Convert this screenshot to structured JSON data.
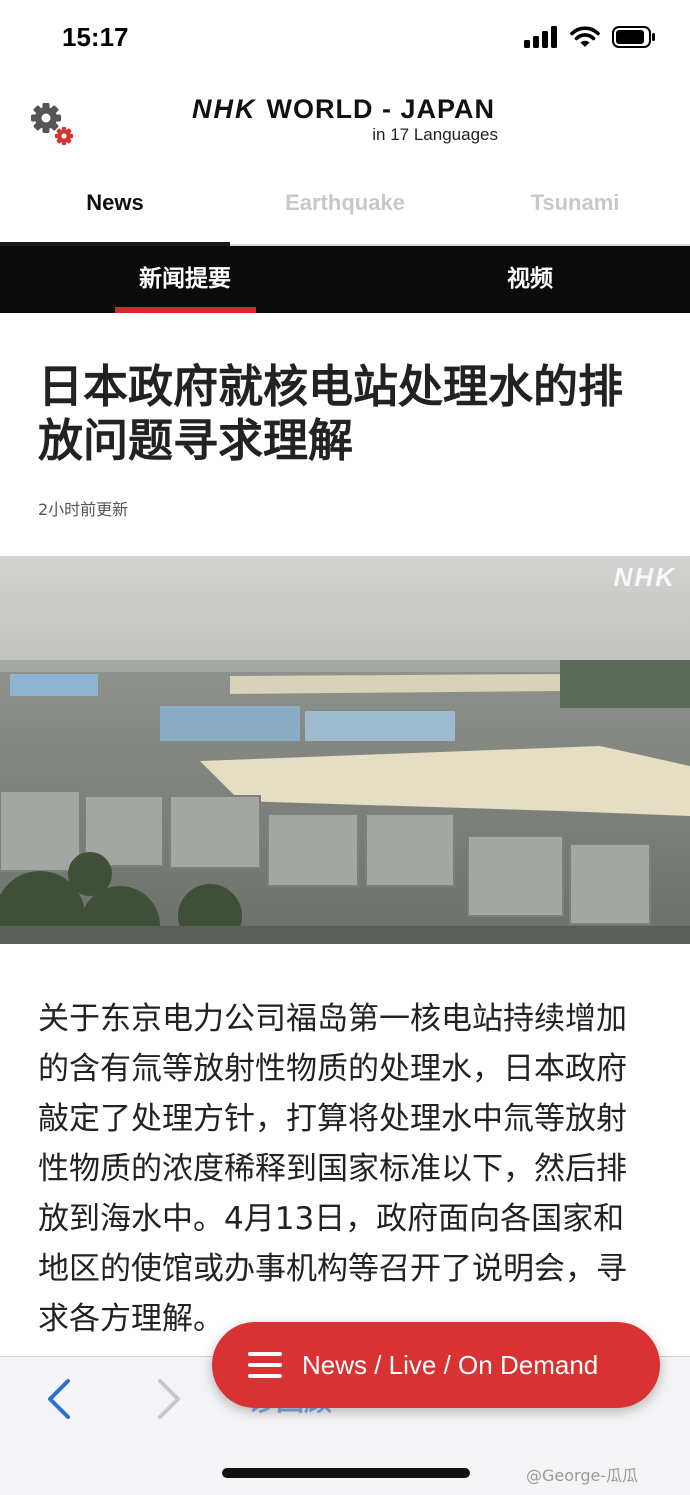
{
  "status_bar": {
    "time": "15:17",
    "icons": [
      "signal-icon",
      "wifi-icon",
      "battery-icon"
    ]
  },
  "header": {
    "logo_nhk": "NHK",
    "logo_rest": "WORLD - JAPAN",
    "subtitle": "in 17 Languages",
    "settings_icon": "gear-icon"
  },
  "tabs": [
    {
      "label": "News",
      "active": true
    },
    {
      "label": "Earthquake",
      "active": false
    },
    {
      "label": "Tsunami",
      "active": false
    }
  ],
  "subnav": [
    {
      "label": "新闻提要",
      "active": true
    },
    {
      "label": "视频",
      "active": false
    }
  ],
  "article": {
    "headline": "日本政府就核电站处理水的排放问题寻求理解",
    "updated": "2小时前更新",
    "photo_watermark": "NHK",
    "body": "关于东京电力公司福岛第一核电站持续增加的含有氚等放射性物质的处理水，日本政府敲定了处理方针，打算将处理水中氚等放射性物质的浓度稀释到国家标准以下，然后排放到海水中。4月13日，政府面向各国家和地区的使馆或办事机构等召开了说明会，寻求各方理解。"
  },
  "fab": {
    "label": "News / Live / On Demand",
    "icon": "menu-icon"
  },
  "browser_bar": {
    "faded_link": "诊回顾"
  },
  "watermark": "@George-瓜瓜",
  "colors": {
    "accent_red": "#d93233",
    "subnav_bg": "#0b0b0b",
    "ios_blue": "#2a6fd6"
  }
}
